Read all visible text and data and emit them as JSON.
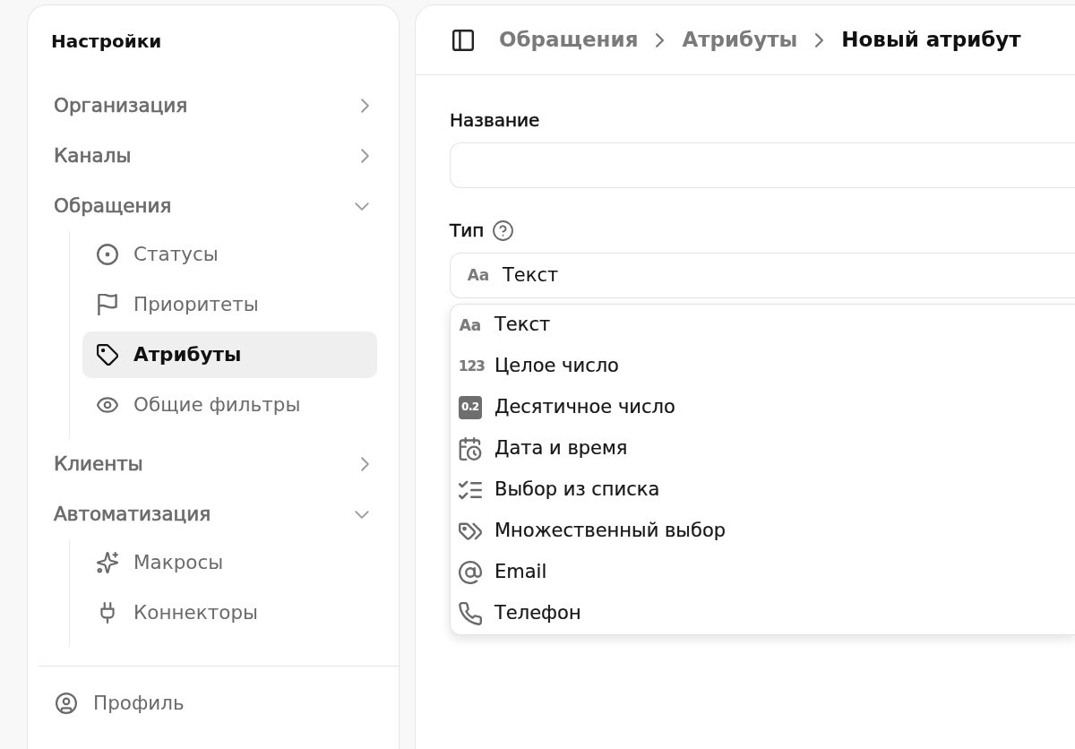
{
  "sidebar": {
    "title": "Настройки",
    "groups": [
      {
        "label": "Организация",
        "expanded": false
      },
      {
        "label": "Каналы",
        "expanded": false
      },
      {
        "label": "Обращения",
        "expanded": true,
        "children": [
          {
            "label": "Статусы",
            "selected": false
          },
          {
            "label": "Приоритеты",
            "selected": false
          },
          {
            "label": "Атрибуты",
            "selected": true
          },
          {
            "label": "Общие фильтры",
            "selected": false
          }
        ]
      },
      {
        "label": "Клиенты",
        "expanded": false
      },
      {
        "label": "Автоматизация",
        "expanded": true,
        "children": [
          {
            "label": "Макросы",
            "selected": false
          },
          {
            "label": "Коннекторы",
            "selected": false
          }
        ]
      }
    ],
    "footer": {
      "label": "Профиль"
    }
  },
  "header": {
    "breadcrumbs": [
      {
        "label": "Обращения",
        "current": false
      },
      {
        "label": "Атрибуты",
        "current": false
      },
      {
        "label": "Новый атрибут",
        "current": true
      }
    ]
  },
  "form": {
    "fields": [
      {
        "kind": "text",
        "label": "Название"
      },
      {
        "kind": "select",
        "label": "Тип",
        "help": true,
        "glyph": "Aa",
        "value": "Текст",
        "open": true,
        "options": [
          {
            "kind": "glyph",
            "glyph": "Aa",
            "label": "Текст"
          },
          {
            "kind": "glyph",
            "glyph": "123",
            "label": "Целое число"
          },
          {
            "kind": "tile",
            "glyph": "0.2",
            "label": "Десятичное число"
          },
          {
            "kind": "calendar",
            "label": "Дата и время"
          },
          {
            "kind": "checklist",
            "label": "Выбор из списка"
          },
          {
            "kind": "tags",
            "label": "Множественный выбор"
          },
          {
            "kind": "at",
            "label": "Email"
          },
          {
            "kind": "phone",
            "label": "Телефон"
          }
        ]
      }
    ]
  }
}
